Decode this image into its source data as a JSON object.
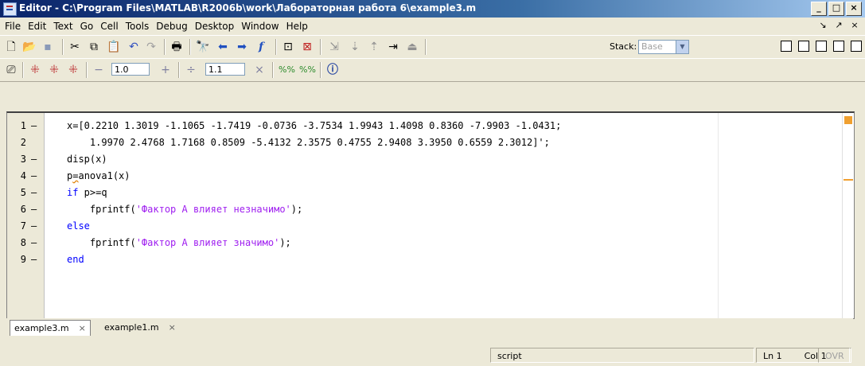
{
  "window": {
    "title": "Editor - C:\\Program Files\\MATLAB\\R2006b\\work\\Лабораторная работа 6\\example3.m",
    "min_glyph": "_",
    "max_glyph": "□",
    "close_glyph": "×"
  },
  "menu": [
    "File",
    "Edit",
    "Text",
    "Go",
    "Cell",
    "Tools",
    "Debug",
    "Desktop",
    "Window",
    "Help"
  ],
  "dock_controls": {
    "undock": "↘",
    "maximize": "↗",
    "close": "×"
  },
  "toolbar": {
    "icons": [
      "new-file-icon",
      "open-icon",
      "save-icon",
      "cut-icon",
      "copy-icon",
      "paste-icon",
      "undo-icon",
      "redo-icon",
      "print-icon",
      "find-icon",
      "back-icon",
      "forward-icon",
      "function-icon",
      "set-breakpoint-icon",
      "clear-breakpoints-icon",
      "step-icon",
      "step-in-icon",
      "step-out-icon",
      "continue-icon",
      "exit-debug-icon"
    ],
    "stack_label": "Stack:",
    "stack_value": "Base"
  },
  "cell_toolbar": {
    "decrement_label": "−",
    "value1": "1.0",
    "increment_label": "+",
    "divide_label": "÷",
    "value2": "1.1",
    "multiply_label": "×"
  },
  "code": {
    "lines": [
      {
        "n": "1",
        "dash": "–",
        "text": "x=[0.2210 1.3019 -1.1065 -1.7419 -0.0736 -3.7534 1.9943 1.4098 0.8360 -7.9903 -1.0431;"
      },
      {
        "n": "2",
        "dash": "",
        "text": "    1.9970 2.4768 1.7168 0.8509 -5.4132 2.3575 0.4755 2.9408 3.3950 0.6559 2.3012]';"
      },
      {
        "n": "3",
        "dash": "–",
        "text": "disp(x)"
      },
      {
        "n": "4",
        "dash": "–",
        "pre": "p",
        "squig": "=",
        "post": "anova1(x)"
      },
      {
        "n": "5",
        "dash": "–",
        "kw": "if",
        "text": " p>=q"
      },
      {
        "n": "6",
        "dash": "–",
        "indent": "    fprintf(",
        "str": "'Фактор А влияет незначимо'",
        "tail": ");"
      },
      {
        "n": "7",
        "dash": "–",
        "kw": "else"
      },
      {
        "n": "8",
        "dash": "–",
        "indent": "    fprintf(",
        "str": "'Фактор А влияет значимо'",
        "tail": ");"
      },
      {
        "n": "9",
        "dash": "–",
        "kw": "end"
      }
    ]
  },
  "tabs": [
    {
      "label": "example3.m",
      "close": "×"
    },
    {
      "label": "example1.m",
      "close": "×"
    }
  ],
  "status": {
    "mode": "script",
    "ln_label": "Ln",
    "ln_value": "1",
    "col_label": "Col",
    "col_value": "1",
    "ovr": "OVR"
  },
  "colors": {
    "keyword": "#0000ff",
    "string": "#a020f0",
    "warning": "#f0a030"
  }
}
